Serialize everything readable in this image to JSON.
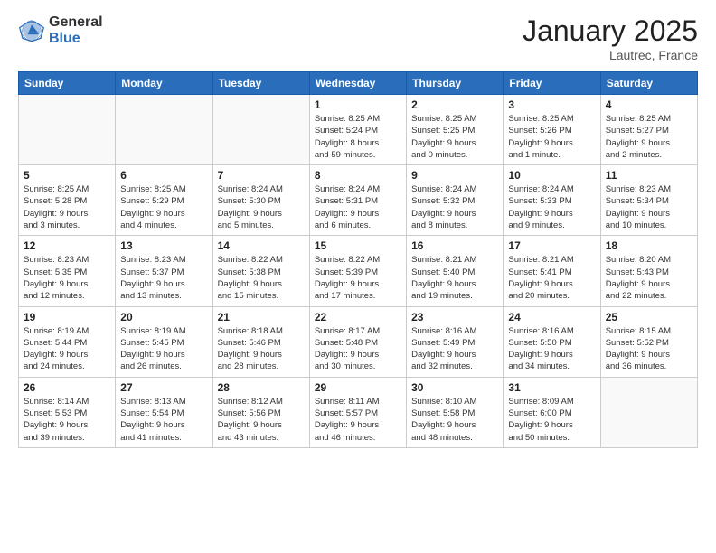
{
  "header": {
    "logo_general": "General",
    "logo_blue": "Blue",
    "month_title": "January 2025",
    "location": "Lautrec, France"
  },
  "days_of_week": [
    "Sunday",
    "Monday",
    "Tuesday",
    "Wednesday",
    "Thursday",
    "Friday",
    "Saturday"
  ],
  "weeks": [
    [
      {
        "day": "",
        "info": ""
      },
      {
        "day": "",
        "info": ""
      },
      {
        "day": "",
        "info": ""
      },
      {
        "day": "1",
        "info": "Sunrise: 8:25 AM\nSunset: 5:24 PM\nDaylight: 8 hours\nand 59 minutes."
      },
      {
        "day": "2",
        "info": "Sunrise: 8:25 AM\nSunset: 5:25 PM\nDaylight: 9 hours\nand 0 minutes."
      },
      {
        "day": "3",
        "info": "Sunrise: 8:25 AM\nSunset: 5:26 PM\nDaylight: 9 hours\nand 1 minute."
      },
      {
        "day": "4",
        "info": "Sunrise: 8:25 AM\nSunset: 5:27 PM\nDaylight: 9 hours\nand 2 minutes."
      }
    ],
    [
      {
        "day": "5",
        "info": "Sunrise: 8:25 AM\nSunset: 5:28 PM\nDaylight: 9 hours\nand 3 minutes."
      },
      {
        "day": "6",
        "info": "Sunrise: 8:25 AM\nSunset: 5:29 PM\nDaylight: 9 hours\nand 4 minutes."
      },
      {
        "day": "7",
        "info": "Sunrise: 8:24 AM\nSunset: 5:30 PM\nDaylight: 9 hours\nand 5 minutes."
      },
      {
        "day": "8",
        "info": "Sunrise: 8:24 AM\nSunset: 5:31 PM\nDaylight: 9 hours\nand 6 minutes."
      },
      {
        "day": "9",
        "info": "Sunrise: 8:24 AM\nSunset: 5:32 PM\nDaylight: 9 hours\nand 8 minutes."
      },
      {
        "day": "10",
        "info": "Sunrise: 8:24 AM\nSunset: 5:33 PM\nDaylight: 9 hours\nand 9 minutes."
      },
      {
        "day": "11",
        "info": "Sunrise: 8:23 AM\nSunset: 5:34 PM\nDaylight: 9 hours\nand 10 minutes."
      }
    ],
    [
      {
        "day": "12",
        "info": "Sunrise: 8:23 AM\nSunset: 5:35 PM\nDaylight: 9 hours\nand 12 minutes."
      },
      {
        "day": "13",
        "info": "Sunrise: 8:23 AM\nSunset: 5:37 PM\nDaylight: 9 hours\nand 13 minutes."
      },
      {
        "day": "14",
        "info": "Sunrise: 8:22 AM\nSunset: 5:38 PM\nDaylight: 9 hours\nand 15 minutes."
      },
      {
        "day": "15",
        "info": "Sunrise: 8:22 AM\nSunset: 5:39 PM\nDaylight: 9 hours\nand 17 minutes."
      },
      {
        "day": "16",
        "info": "Sunrise: 8:21 AM\nSunset: 5:40 PM\nDaylight: 9 hours\nand 19 minutes."
      },
      {
        "day": "17",
        "info": "Sunrise: 8:21 AM\nSunset: 5:41 PM\nDaylight: 9 hours\nand 20 minutes."
      },
      {
        "day": "18",
        "info": "Sunrise: 8:20 AM\nSunset: 5:43 PM\nDaylight: 9 hours\nand 22 minutes."
      }
    ],
    [
      {
        "day": "19",
        "info": "Sunrise: 8:19 AM\nSunset: 5:44 PM\nDaylight: 9 hours\nand 24 minutes."
      },
      {
        "day": "20",
        "info": "Sunrise: 8:19 AM\nSunset: 5:45 PM\nDaylight: 9 hours\nand 26 minutes."
      },
      {
        "day": "21",
        "info": "Sunrise: 8:18 AM\nSunset: 5:46 PM\nDaylight: 9 hours\nand 28 minutes."
      },
      {
        "day": "22",
        "info": "Sunrise: 8:17 AM\nSunset: 5:48 PM\nDaylight: 9 hours\nand 30 minutes."
      },
      {
        "day": "23",
        "info": "Sunrise: 8:16 AM\nSunset: 5:49 PM\nDaylight: 9 hours\nand 32 minutes."
      },
      {
        "day": "24",
        "info": "Sunrise: 8:16 AM\nSunset: 5:50 PM\nDaylight: 9 hours\nand 34 minutes."
      },
      {
        "day": "25",
        "info": "Sunrise: 8:15 AM\nSunset: 5:52 PM\nDaylight: 9 hours\nand 36 minutes."
      }
    ],
    [
      {
        "day": "26",
        "info": "Sunrise: 8:14 AM\nSunset: 5:53 PM\nDaylight: 9 hours\nand 39 minutes."
      },
      {
        "day": "27",
        "info": "Sunrise: 8:13 AM\nSunset: 5:54 PM\nDaylight: 9 hours\nand 41 minutes."
      },
      {
        "day": "28",
        "info": "Sunrise: 8:12 AM\nSunset: 5:56 PM\nDaylight: 9 hours\nand 43 minutes."
      },
      {
        "day": "29",
        "info": "Sunrise: 8:11 AM\nSunset: 5:57 PM\nDaylight: 9 hours\nand 46 minutes."
      },
      {
        "day": "30",
        "info": "Sunrise: 8:10 AM\nSunset: 5:58 PM\nDaylight: 9 hours\nand 48 minutes."
      },
      {
        "day": "31",
        "info": "Sunrise: 8:09 AM\nSunset: 6:00 PM\nDaylight: 9 hours\nand 50 minutes."
      },
      {
        "day": "",
        "info": ""
      }
    ]
  ]
}
